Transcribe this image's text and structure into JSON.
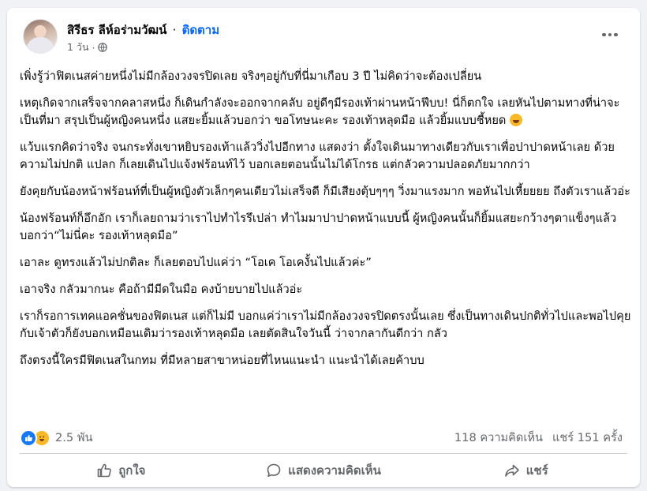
{
  "post": {
    "author": "สิรีธร ลีห์อร่ามวัฒน์",
    "separator": "·",
    "follow_label": "ติดตาม",
    "time": "1 วัน",
    "paragraphs": [
      "เพิ่งรู้ว่าฟิตเนสค่ายหนึ่งไม่มีกล้องวงจรปิดเลย จริงๆอยู่กับที่นี่มาเกือบ 3 ปี  ไม่คิดว่าจะต้องเปลี่ยน",
      "เหตุเกิดจากเสร็จจากคลาสหนึ่ง ก็เดินกำลังจะออกจากคลับ อยู่ดีๆมีรองเท้าผ่านหน้าฟึบบ! นี่ก็ตกใจ เลยหันไปตามทางที่น่าจะเป็นที่มา สรุปเป็นผู้หญิงคนหนึ่ง แสยะยิ้มแล้วบอกว่า ขอโทษนะคะ รองเท้าหลุดมือ แล้วยิ้มแบบชี้หยด",
      "แว้บแรกคิดว่าจริง จนกระทั่งเขาหยิบรองเท้าแล้ววิ่งไปอีกทาง แสดงว่า ตั้งใจเดินมาทางเดียวกับเราเพื่อปาปาดหน้าเลย ด้วยความไม่ปกติ แปลก ก็เลยเดินไปแจ้งฟร้อนท์ไว้ บอกเลยตอนนั้นไม่ได้โกรธ แต่กลัวความปลอดภัยมากกว่า",
      "ยังคุยกับน้องหน้าฟร้อนท์ที่เป็นผู้หญิงตัวเล็กๆคนเดียวไม่เสร็จดี ก็มีเสียงตุ้บๆๆๆ วิ่งมาแรงมาก พอหันไปเหี้ยยยย ถึงตัวเราแล้วอ่ะ",
      "น้องฟร้อนท์ก็อึกอัก เราก็เลยถามว่าเราไปทำไรรึเปล่า ทำไมมาปาปาดหน้าแบบนี้ ผู้หญิงคนนั้นก็ยิ้มแสยะกว้างๆตาแข็งๆแล้วบอกว่า“ไม่นี่คะ รองเท้าหลุดมือ”",
      "เอาละ  ดูทรงแล้วไม่ปกติละ ก็เลยตอบไปแค่ว่า “โอเค โอเคงั้นไปแล้วค่ะ”",
      "เอาจริง กลัวมากนะ คือถ้ามีมีดในมือ คงบ้ายบายไปแล้วอ่ะ",
      "เราก็รอการเทคแอคชั่นของฟิตเนส แต่ก็ไม่มี บอกแค่ว่าเราไม่มีกล้องวงจรปิดตรงนั้นเลย  ซึ่งเป็นทางเดินปกติทั่วไปและพอไปคุยกับเจ้าตัวก็ยังบอกเหมือนเดิมว่ารองเท้าหลุดมือ  เลยตัดสินใจวันนี้ ว่าจากลากันดีกว่า กลัว",
      "ถึงตรงนี้ใครมีฟิตเนสในกทม ที่มีหลายสาขาหน่อยที่ไหนแนะนำ แนะนำได้เลยค้าบบ"
    ]
  },
  "stats": {
    "reactions": "2.5 พัน",
    "comments": "118 ความคิดเห็น",
    "shares": "แชร์ 151 ครั้ง"
  },
  "actions": {
    "like": "ถูกใจ",
    "comment": "แสดงความคิดเห็น",
    "share": "แชร์"
  },
  "colors": {
    "accent": "#0866ff",
    "muted": "#65676b",
    "like": "#1877f2",
    "haha": "#f7b928"
  }
}
